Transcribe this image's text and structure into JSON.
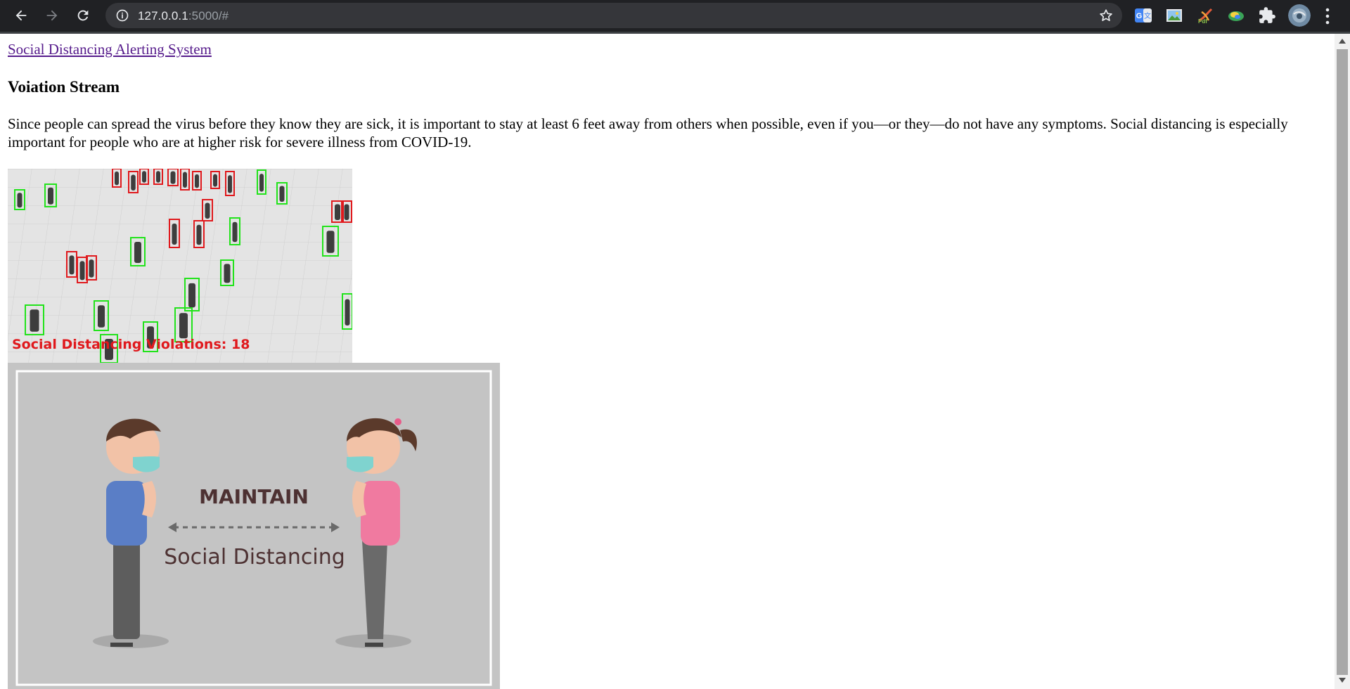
{
  "browser": {
    "url_host": "127.0.0.1",
    "url_rest": ":5000/#",
    "extensions": [
      "google-translate-icon",
      "image-extension-icon",
      "pdf-extension-icon",
      "earth-extension-icon",
      "extensions-puzzle-icon",
      "profile-avatar"
    ]
  },
  "page": {
    "brand_link": "Social Distancing Alerting System",
    "heading": "Voiation Stream",
    "description": "Since people can spread the virus before they know they are sick, it is important to stay at least 6 feet away from others when possible, even if you—or they—do not have any symptoms. Social distancing is especially important for people who are at higher risk for severe illness from COVID-19."
  },
  "stream": {
    "overlay_text": "Social Distancing Violations: 18",
    "violation_color": "#e0191d",
    "safe_color": "#22e31b"
  },
  "poster": {
    "title": "MAINTAIN",
    "subtitle": "Social Distancing"
  },
  "colors": {
    "link": "#551a8b",
    "chrome_bg": "#202124",
    "omnibox_bg": "#35363a"
  }
}
